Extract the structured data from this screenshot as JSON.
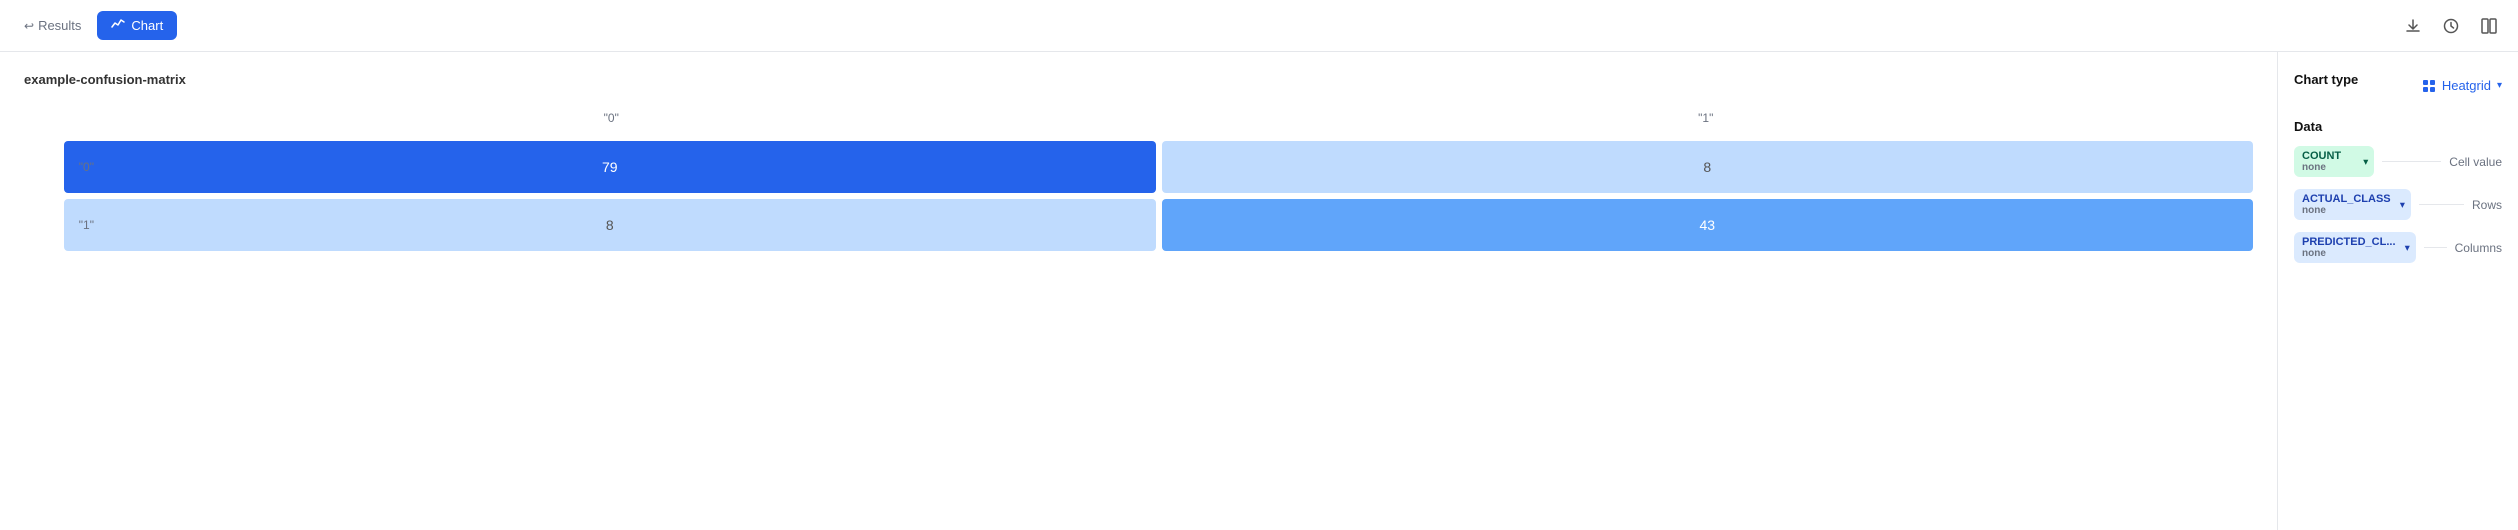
{
  "topbar": {
    "results_label": "Results",
    "chart_label": "Chart",
    "download_icon": "↓",
    "clock_icon": "🕐",
    "layout_icon": "⊟"
  },
  "chart": {
    "title": "example-confusion-matrix",
    "col_headers": [
      "\"0\"",
      "\"1\""
    ],
    "rows": [
      {
        "label": "\"0\"",
        "cells": [
          {
            "value": "79",
            "style": "high"
          },
          {
            "value": "8",
            "style": "low"
          }
        ]
      },
      {
        "label": "\"1\"",
        "cells": [
          {
            "value": "8",
            "style": "low"
          },
          {
            "value": "43",
            "style": "mid"
          }
        ]
      }
    ]
  },
  "right_panel": {
    "chart_type_label": "Chart type",
    "heatgrid_label": "Heatgrid",
    "data_label": "Data",
    "count_badge": "COUNT",
    "count_sub": "none",
    "cell_value_label": "Cell value",
    "actual_class_badge": "ACTUAL_CLASS",
    "actual_class_sub": "none",
    "rows_label": "Rows",
    "predicted_badge": "PREDICTED_CL...",
    "predicted_sub": "none",
    "columns_label": "Columns"
  }
}
